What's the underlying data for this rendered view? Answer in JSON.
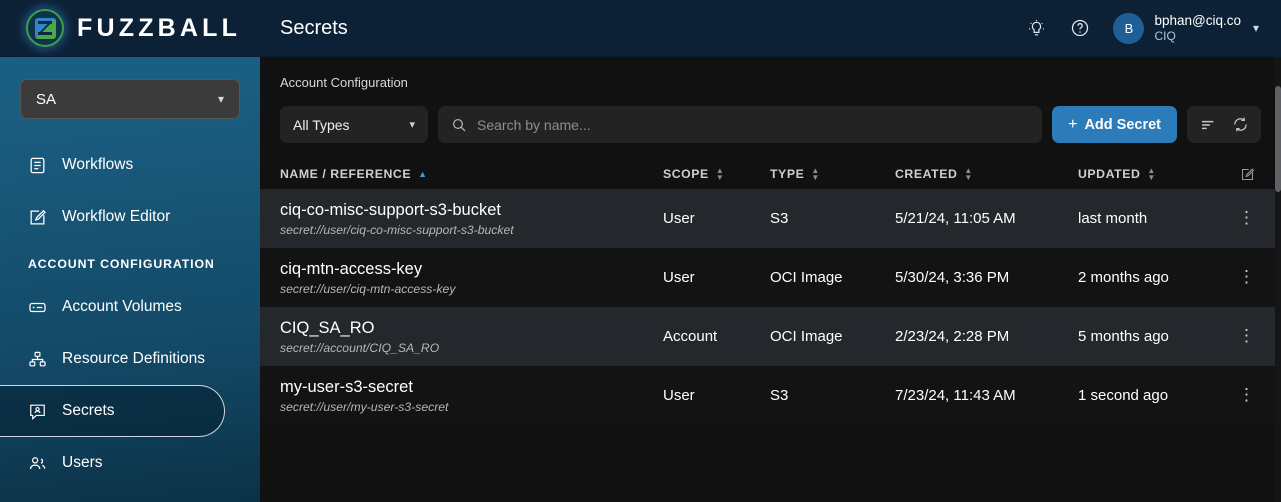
{
  "brand": {
    "name": "FUZZBALL",
    "logo_icon": "fuzzball-logo-icon"
  },
  "sidebar": {
    "account_selector": {
      "value": "SA",
      "chevron": "chevron-down-icon"
    },
    "items": [
      {
        "label": "Workflows",
        "icon": "list-document-icon",
        "active": false
      },
      {
        "label": "Workflow Editor",
        "icon": "edit-square-icon",
        "active": false
      }
    ],
    "section_label": "ACCOUNT CONFIGURATION",
    "config_items": [
      {
        "label": "Account Volumes",
        "icon": "drive-icon",
        "active": false
      },
      {
        "label": "Resource Definitions",
        "icon": "sitemap-icon",
        "active": false
      },
      {
        "label": "Secrets",
        "icon": "secret-badge-icon",
        "active": true
      },
      {
        "label": "Users",
        "icon": "users-icon",
        "active": false
      }
    ]
  },
  "header": {
    "title": "Secrets",
    "theme_icon": "lightbulb-icon",
    "help_icon": "question-circle-icon",
    "user": {
      "avatar_initial": "B",
      "email": "bphan@ciq.co",
      "org": "CIQ",
      "chevron": "chevron-down-icon"
    }
  },
  "breadcrumb": "Account Configuration",
  "toolbar": {
    "type_filter": {
      "value": "All Types",
      "chevron": "chevron-down-icon"
    },
    "search": {
      "value": "",
      "placeholder": "Search by name...",
      "icon": "search-icon"
    },
    "add_button": {
      "label": "Add Secret",
      "plus": "+",
      "color": "#2b7cb8"
    },
    "filter_icon": "filter-sort-icon",
    "refresh_icon": "refresh-icon"
  },
  "table": {
    "columns": [
      {
        "label": "NAME / REFERENCE",
        "sort": "asc"
      },
      {
        "label": "SCOPE",
        "sort": "both"
      },
      {
        "label": "TYPE",
        "sort": "both"
      },
      {
        "label": "CREATED",
        "sort": "both"
      },
      {
        "label": "UPDATED",
        "sort": "both"
      }
    ],
    "edit_columns_icon": "edit-square-icon",
    "row_menu_icon": "kebab-menu-icon",
    "rows": [
      {
        "name": "ciq-co-misc-support-s3-bucket",
        "reference": "secret://user/ciq-co-misc-support-s3-bucket",
        "scope": "User",
        "type": "S3",
        "created": "5/21/24, 11:05 AM",
        "updated": "last month"
      },
      {
        "name": "ciq-mtn-access-key",
        "reference": "secret://user/ciq-mtn-access-key",
        "scope": "User",
        "type": "OCI Image",
        "created": "5/30/24, 3:36 PM",
        "updated": "2 months ago"
      },
      {
        "name": "CIQ_SA_RO",
        "reference": "secret://account/CIQ_SA_RO",
        "scope": "Account",
        "type": "OCI Image",
        "created": "2/23/24, 2:28 PM",
        "updated": "5 months ago"
      },
      {
        "name": "my-user-s3-secret",
        "reference": "secret://user/my-user-s3-secret",
        "scope": "User",
        "type": "S3",
        "created": "7/23/24, 11:43 AM",
        "updated": "1 second ago"
      }
    ]
  }
}
